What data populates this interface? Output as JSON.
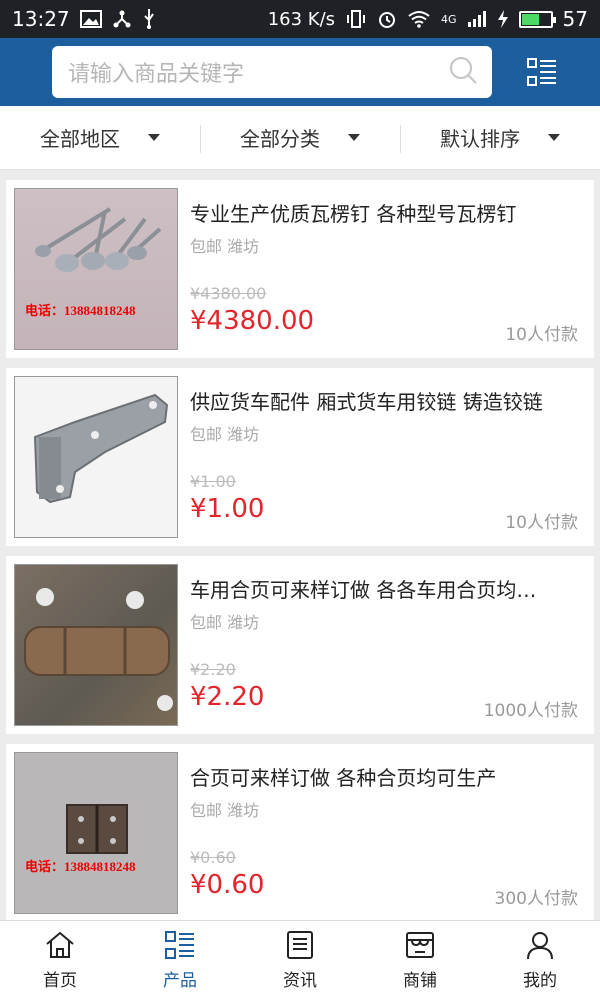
{
  "status_bar": {
    "time": "13:27",
    "speed": "163 K/s",
    "network": "4G",
    "battery": "57"
  },
  "search": {
    "placeholder": "请输入商品关键字"
  },
  "filters": [
    {
      "label": "全部地区"
    },
    {
      "label": "全部分类"
    },
    {
      "label": "默认排序"
    }
  ],
  "products": [
    {
      "title": "专业生产优质瓦楞钉 各种型号瓦楞钉",
      "meta": "包邮 潍坊",
      "old_price": "¥4380.00",
      "price": "¥4380.00",
      "sold": "10人付款",
      "image_text": "电话：13884818248"
    },
    {
      "title": "供应货车配件 厢式货车用铰链 铸造铰链",
      "meta": "包邮 潍坊",
      "old_price": "¥1.00",
      "price": "¥1.00",
      "sold": "10人付款",
      "image_text": ""
    },
    {
      "title": "车用合页可来样订做 各各车用合页均…",
      "meta": "包邮 潍坊",
      "old_price": "¥2.20",
      "price": "¥2.20",
      "sold": "1000人付款",
      "image_text": ""
    },
    {
      "title": "合页可来样订做 各种合页均可生产",
      "meta": "包邮 潍坊",
      "old_price": "¥0.60",
      "price": "¥0.60",
      "sold": "300人付款",
      "image_text": "电话：13884818248"
    }
  ],
  "tabs": [
    {
      "label": "首页",
      "icon": "home-icon"
    },
    {
      "label": "产品",
      "icon": "product-grid-icon"
    },
    {
      "label": "资讯",
      "icon": "news-icon"
    },
    {
      "label": "商铺",
      "icon": "shop-icon"
    },
    {
      "label": "我的",
      "icon": "user-icon"
    }
  ],
  "colors": {
    "header": "#1d5f9e",
    "price": "#e4242b",
    "active_tab": "#1d5f9e"
  }
}
